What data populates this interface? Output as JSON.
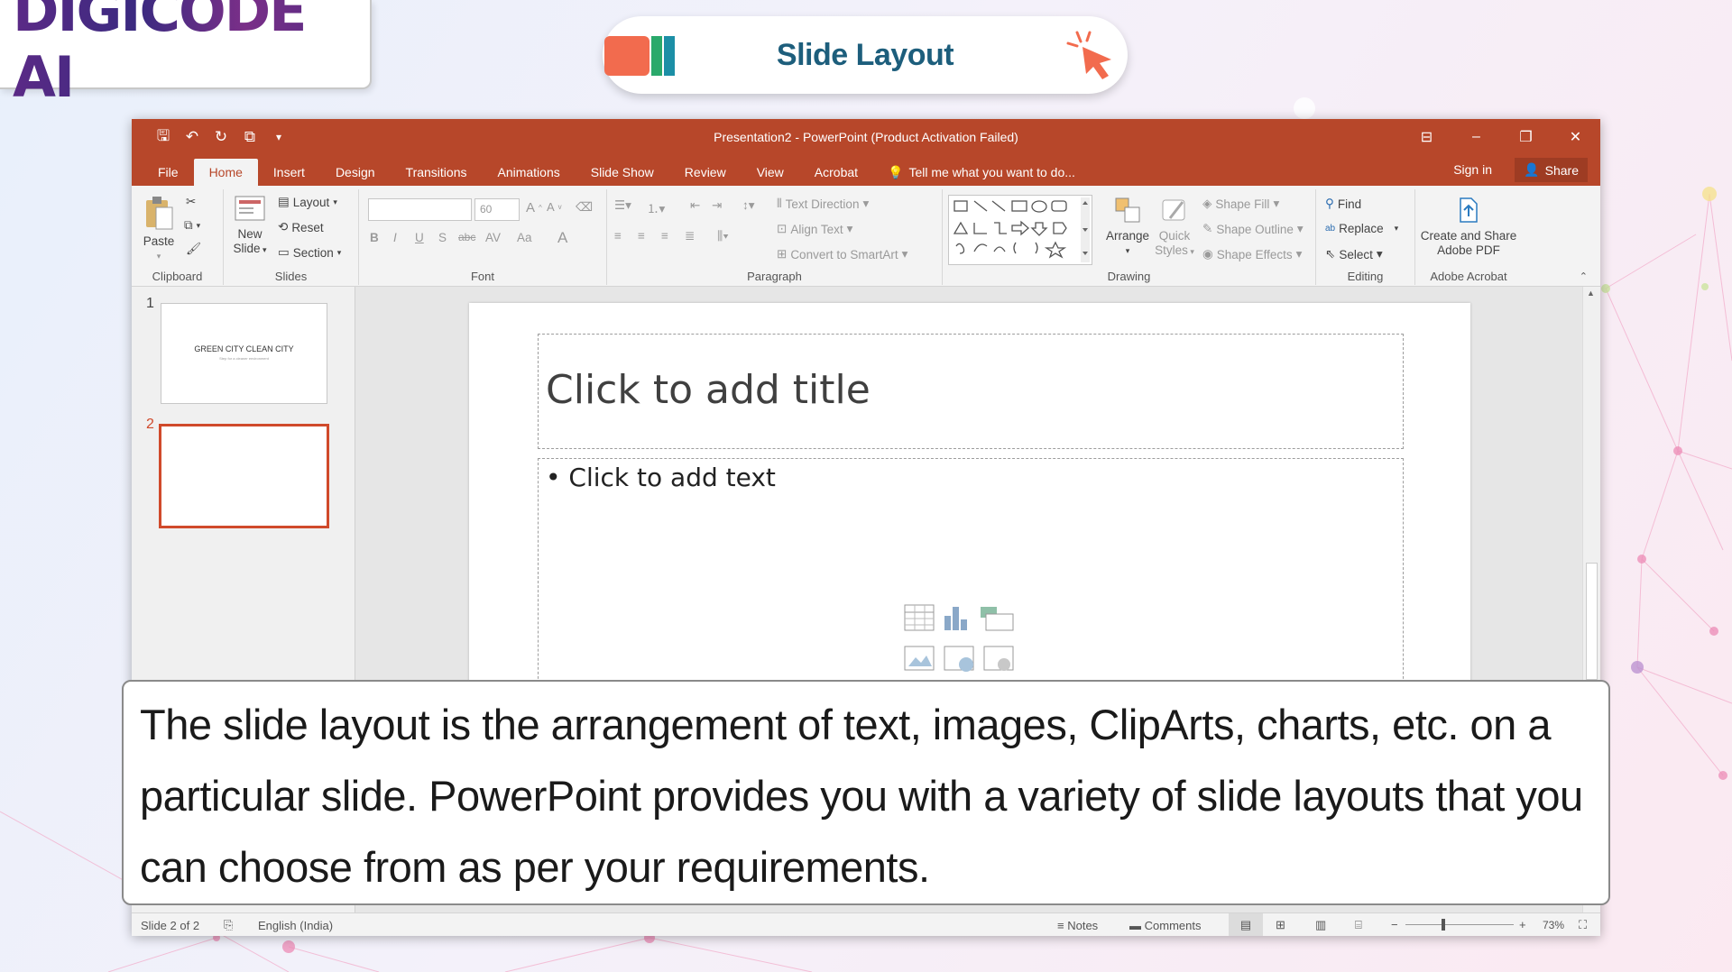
{
  "brand": {
    "logo_text": "DIGICODE AI",
    "accent_orange": "#f26b4e",
    "accent_green": "#2aa96b",
    "accent_teal": "#1c8fa6"
  },
  "header": {
    "title": "Slide Layout",
    "title_color": "#1d5e7c"
  },
  "window": {
    "title": "Presentation2 - PowerPoint (Product Activation Failed)",
    "theme_color": "#b7472a",
    "qat_icons": [
      "save-icon",
      "undo-icon",
      "redo-icon",
      "start-from-beginning-icon",
      "customize-qat-icon"
    ]
  },
  "tabs": [
    "File",
    "Home",
    "Insert",
    "Design",
    "Transitions",
    "Animations",
    "Slide Show",
    "Review",
    "View",
    "Acrobat"
  ],
  "active_tab": "Home",
  "tell_me": "Tell me what you want to do...",
  "sign_in": "Sign in",
  "share": "Share",
  "ribbon": {
    "clipboard": {
      "label": "Clipboard",
      "paste": "Paste"
    },
    "slides": {
      "label": "Slides",
      "new_slide": "New",
      "new_slide2": "Slide",
      "layout": "Layout",
      "reset": "Reset",
      "section": "Section"
    },
    "font": {
      "label": "Font",
      "font_name": "",
      "font_size": "60",
      "bold": "B",
      "italic": "I",
      "underline": "U",
      "shadow": "S",
      "strike": "abc",
      "spacing": "AV",
      "case": "Aa",
      "color": "A"
    },
    "paragraph": {
      "label": "Paragraph",
      "text_direction": "Text Direction",
      "align_text": "Align Text",
      "smartart": "Convert to SmartArt"
    },
    "drawing": {
      "label": "Drawing",
      "arrange": "Arrange",
      "quick": "Quick",
      "styles": "Styles",
      "shape_fill": "Shape Fill",
      "shape_outline": "Shape Outline",
      "shape_effects": "Shape Effects"
    },
    "editing": {
      "label": "Editing",
      "find": "Find",
      "replace": "Replace",
      "select": "Select"
    },
    "acrobat": {
      "label": "Adobe Acrobat",
      "create1": "Create and Share",
      "create2": "Adobe PDF"
    }
  },
  "thumbnails": [
    {
      "num": "1",
      "title": "GREEN CITY CLEAN CITY",
      "subtitle": "Step for a cleaner environment"
    },
    {
      "num": "2",
      "title": "",
      "subtitle": ""
    }
  ],
  "slide": {
    "title_placeholder": "Click to add title",
    "body_placeholder": "• Click to add text"
  },
  "status": {
    "slide_info": "Slide 2 of 2",
    "language": "English (India)",
    "notes": "Notes",
    "comments": "Comments",
    "zoom": "73%"
  },
  "caption": "The slide layout is the arrangement of text, images, ClipArts, charts, etc. on a particular slide. PowerPoint provides you with a variety of slide layouts that you can choose from as per your requirements."
}
